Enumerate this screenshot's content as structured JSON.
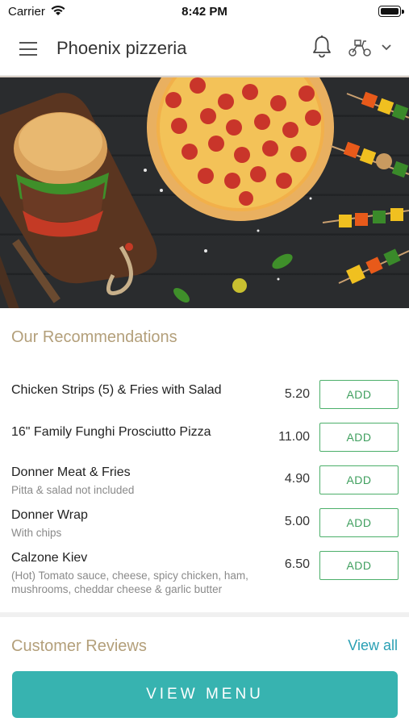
{
  "status_bar": {
    "carrier": "Carrier",
    "time": "8:42 PM"
  },
  "header": {
    "title": "Phoenix pizzeria"
  },
  "icons": {
    "menu": "hamburger-icon",
    "notifications": "bell-icon",
    "delivery": "scooter-icon",
    "dropdown": "chevron-down-icon"
  },
  "recommendations": {
    "title": "Our Recommendations",
    "items": [
      {
        "name": "Chicken Strips (5) & Fries with Salad",
        "description": "",
        "price": "5.20",
        "button": "ADD"
      },
      {
        "name": "16\" Family Funghi Prosciutto Pizza",
        "description": "",
        "price": "11.00",
        "button": "ADD"
      },
      {
        "name": "Donner Meat & Fries",
        "description": "Pitta & salad not included",
        "price": "4.90",
        "button": "ADD"
      },
      {
        "name": "Donner Wrap",
        "description": "With chips",
        "price": "5.00",
        "button": "ADD"
      },
      {
        "name": "Calzone Kiev",
        "description": "(Hot) Tomato sauce, cheese, spicy chicken, ham, mushrooms, cheddar cheese & garlic butter",
        "price": "6.50",
        "button": "ADD"
      }
    ]
  },
  "reviews": {
    "title": "Customer Reviews",
    "view_all": "View all"
  },
  "cta": {
    "label": "VIEW MENU"
  },
  "colors": {
    "accent": "#37b3b0",
    "add_green": "#4caf6a",
    "section_title": "#b39f7a",
    "link": "#2aa0b4"
  }
}
